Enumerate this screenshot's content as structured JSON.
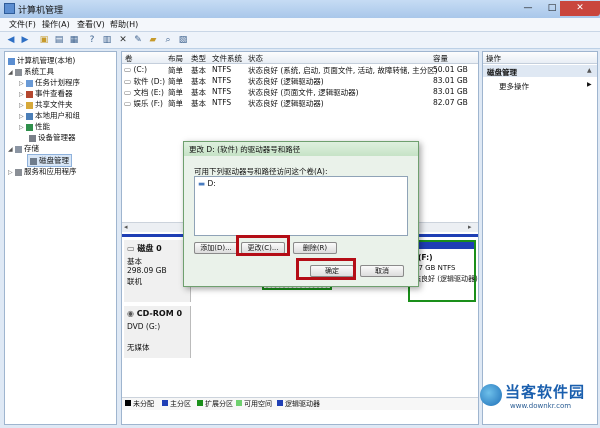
{
  "window": {
    "title": "计算机管理"
  },
  "window_controls": {
    "minimize": "—",
    "maximize": "□",
    "close": "✕"
  },
  "menu": [
    "文件(F)",
    "操作(A)",
    "查看(V)",
    "帮助(H)"
  ],
  "tree": {
    "root": "计算机管理(本地)",
    "system_tools": "系统工具",
    "task_scheduler": "任务计划程序",
    "event_viewer": "事件查看器",
    "shared_folders": "共享文件夹",
    "local_users": "本地用户和组",
    "performance": "性能",
    "device_manager": "设备管理器",
    "storage": "存储",
    "disk_management": "磁盘管理",
    "services_apps": "服务和应用程序"
  },
  "volume_table": {
    "headers": [
      "卷",
      "布局",
      "类型",
      "文件系统",
      "状态",
      "容量"
    ],
    "rows": [
      [
        "(C:)",
        "简单",
        "基本",
        "NTFS",
        "状态良好 (系统, 启动, 页面文件, 活动, 故障转储, 主分区)",
        "50.01 GB"
      ],
      [
        "软件 (D:)",
        "简单",
        "基本",
        "NTFS",
        "状态良好 (逻辑驱动器)",
        "83.01 GB"
      ],
      [
        "文档 (E:)",
        "简单",
        "基本",
        "NTFS",
        "状态良好 (页面文件, 逻辑驱动器)",
        "83.01 GB"
      ],
      [
        "娱乐 (F:)",
        "简单",
        "基本",
        "NTFS",
        "状态良好 (逻辑驱动器)",
        "82.07 GB"
      ]
    ]
  },
  "actions": {
    "header": "操作",
    "section": "磁盘管理",
    "more": "更多操作"
  },
  "disks": {
    "disk0": {
      "name": "磁盘 0",
      "type": "基本",
      "size": "298.09 GB",
      "status": "联机"
    },
    "cdrom0": {
      "name": "CD-ROM 0",
      "type": "DVD (G:)",
      "status": "无媒体"
    },
    "partition_f": {
      "name": "(F:)",
      "size": "07 GB NTFS",
      "status": "态良好 (逻辑驱动器)"
    }
  },
  "legend": [
    "未分配",
    "主分区",
    "扩展分区",
    "可用空间",
    "逻辑驱动器"
  ],
  "legend_colors": [
    "#000000",
    "#1f3fb5",
    "#1a8f1a",
    "#6fd06f",
    "#1f3fb5"
  ],
  "dialog": {
    "title": "更改 D: (软件) 的驱动器号和路径",
    "prompt": "可用下列驱动器号和路径访问这个卷(A):",
    "list_item": "D:",
    "add": "添加(D)...",
    "change": "更改(C)...",
    "remove": "删除(R)",
    "ok": "确定",
    "cancel": "取消"
  },
  "watermark": {
    "brand": "当客软件园",
    "url": "www.downkr.com"
  }
}
